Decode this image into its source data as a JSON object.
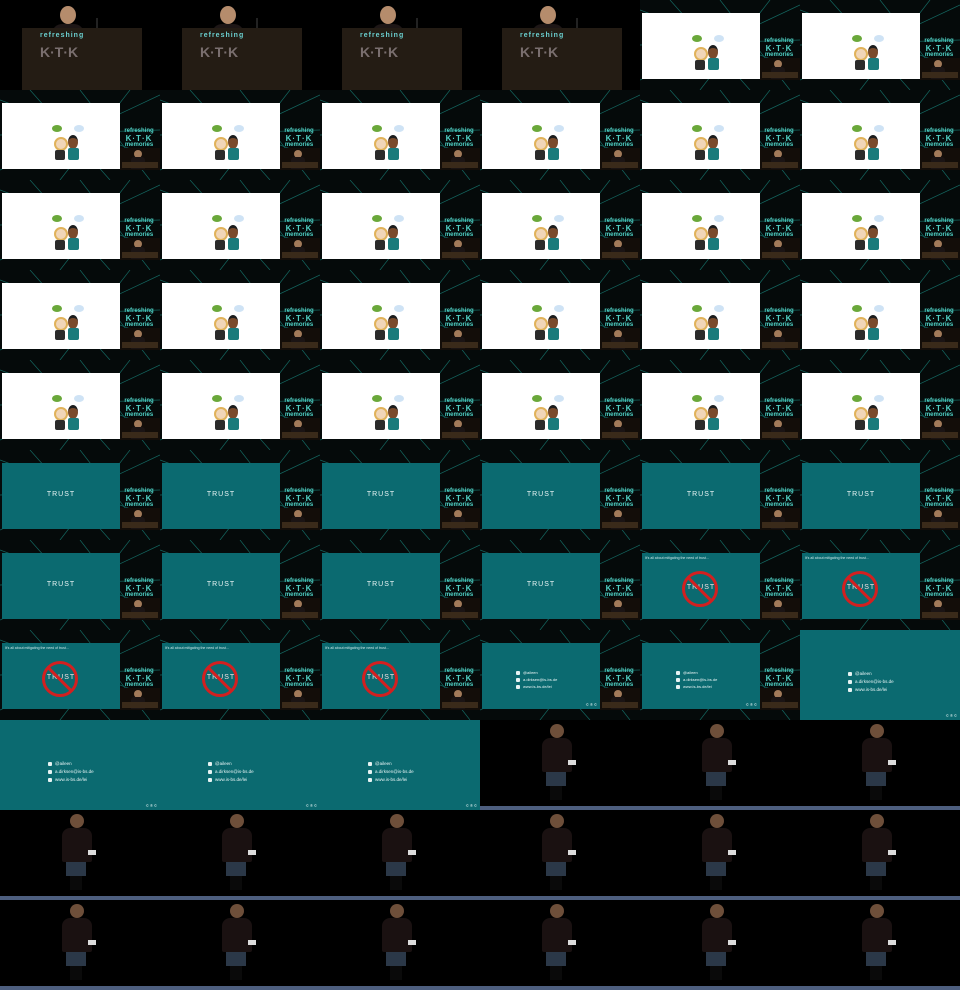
{
  "grid": {
    "columns": 6,
    "rows": 11
  },
  "brand": {
    "line1": "refreshing",
    "line2": "K·T·K",
    "line3": "memories"
  },
  "stage_banner": {
    "label": "refreshing",
    "logo": "K·T·K"
  },
  "slides": {
    "trust_title": "TRUST",
    "trust_caption": "It's all about mitigating the need of trust...",
    "contact": {
      "twitter": "@aileen",
      "email": "a.dirksen@is-bs.de",
      "web": "www.is-bs.de/lei"
    },
    "cc_badge": "© ® ©"
  },
  "cells": [
    "stage",
    "stage",
    "stage",
    "stage",
    "white",
    "white",
    "white",
    "white",
    "white",
    "white",
    "white",
    "white",
    "white",
    "white",
    "white",
    "white",
    "white",
    "white",
    "white",
    "white",
    "white",
    "white",
    "white",
    "white",
    "white",
    "white",
    "white",
    "white",
    "white",
    "white",
    "trust",
    "trust",
    "trust",
    "trust",
    "trust",
    "trust",
    "trust",
    "trust",
    "trust",
    "trust",
    "notrust",
    "notrust",
    "notrust",
    "notrust",
    "notrust",
    "contact",
    "contact",
    "fullcontact",
    "fullcontact",
    "fullcontact",
    "fullcontact",
    "dark",
    "dark",
    "dark",
    "dark",
    "dark",
    "dark",
    "dark",
    "dark",
    "dark",
    "dark",
    "dark",
    "dark",
    "dark",
    "dark",
    "dark"
  ]
}
